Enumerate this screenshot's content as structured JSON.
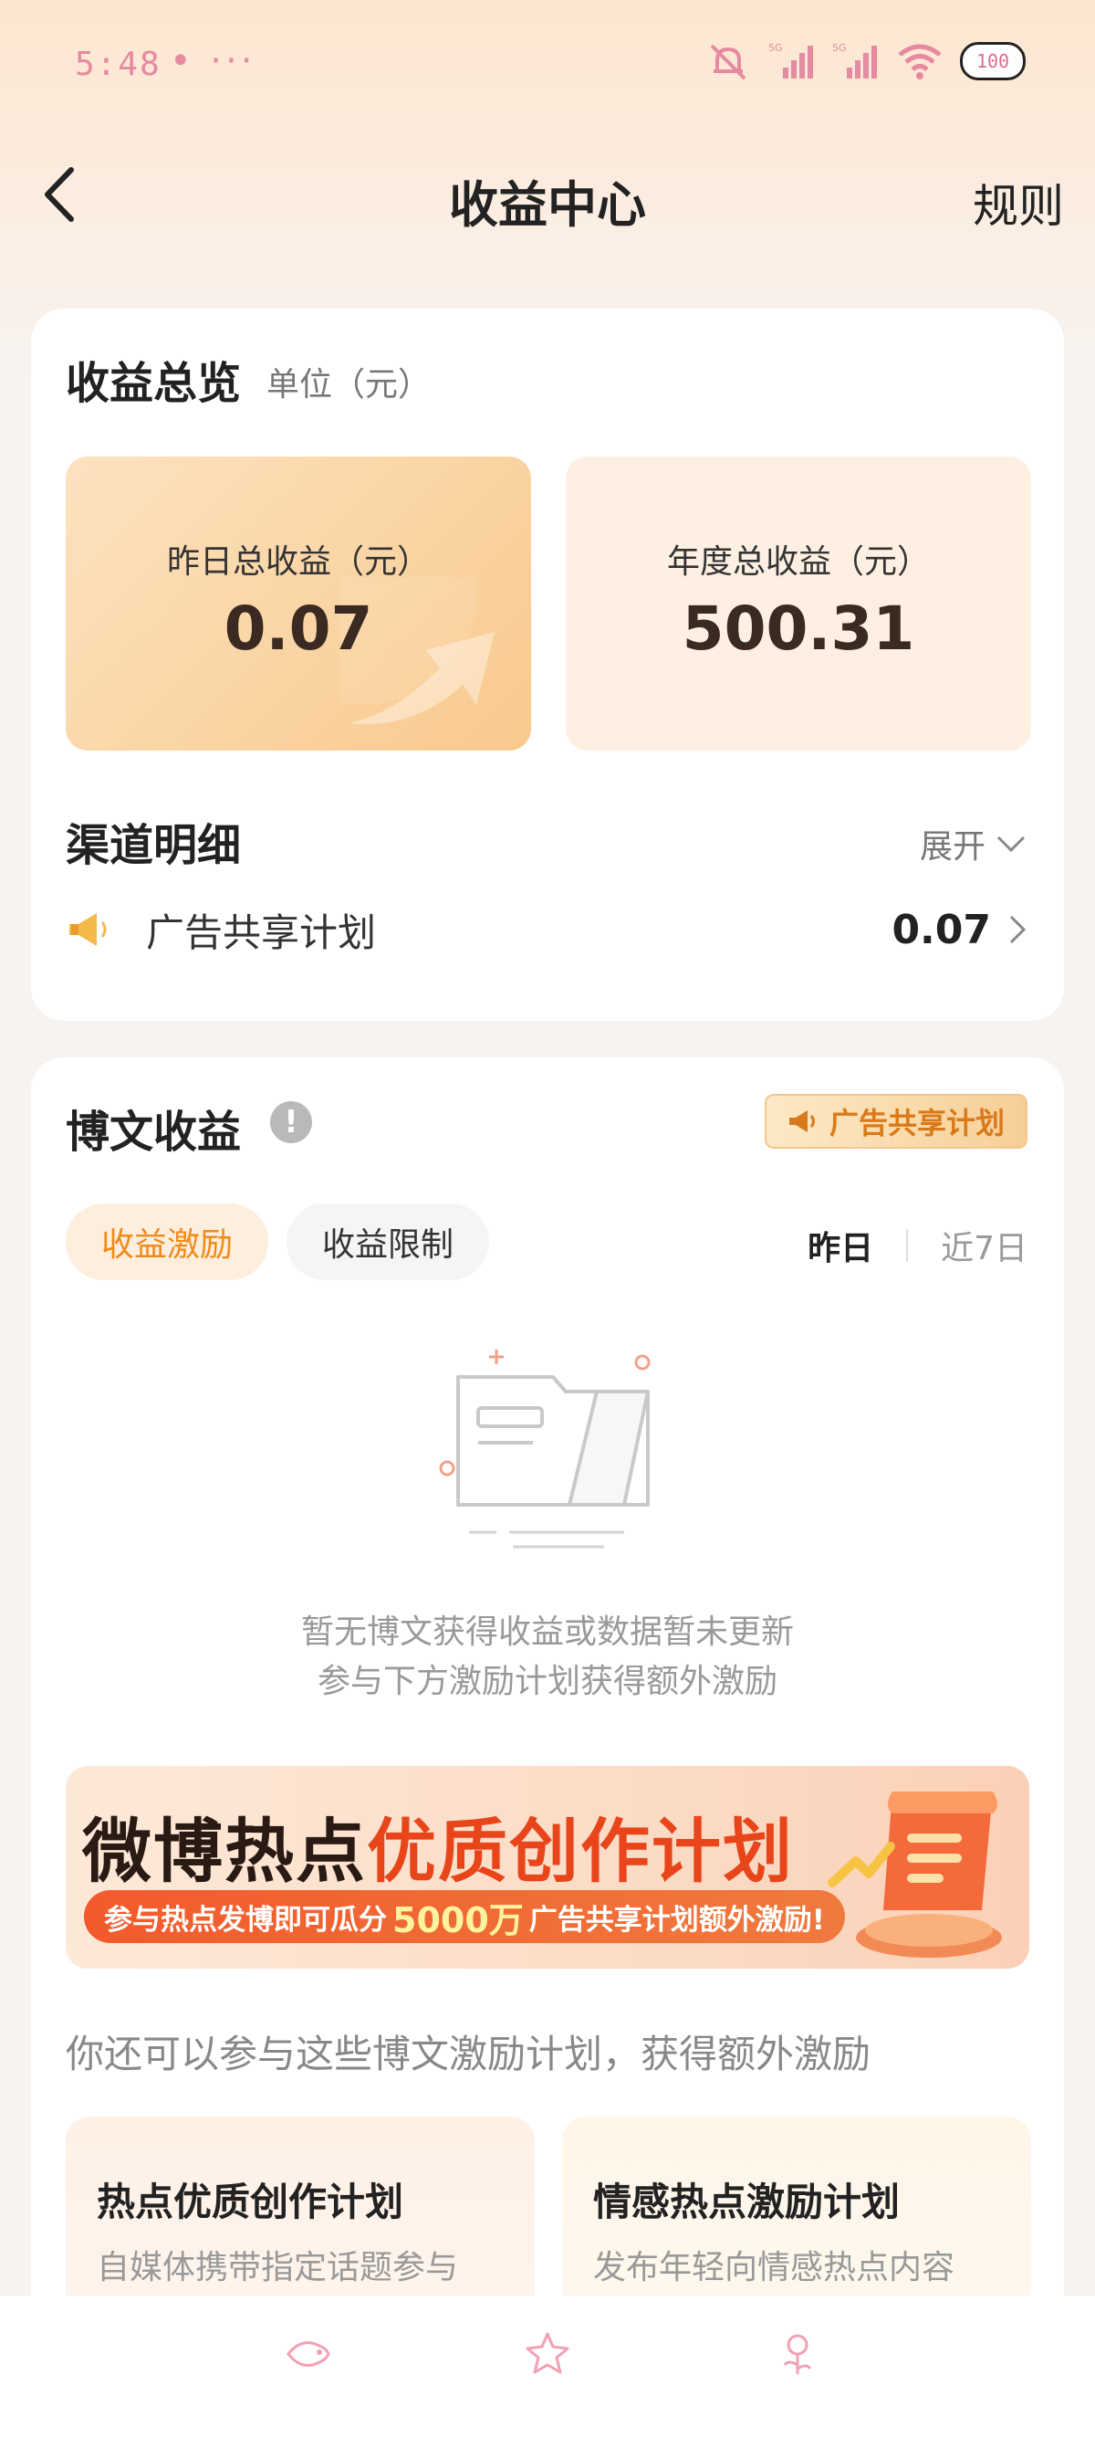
{
  "status_bar": {
    "time": "5:48",
    "dots": "• ···",
    "signal_label_1": "5G",
    "signal_label_2": "5G",
    "battery": "100"
  },
  "nav": {
    "title": "收益中心",
    "rules": "规则"
  },
  "overview": {
    "title": "收益总览",
    "unit": "单位（元）",
    "yesterday_label": "昨日总收益（元）",
    "yesterday_value": "0.07",
    "annual_label": "年度总收益（元）",
    "annual_value": "500.31"
  },
  "channel": {
    "title": "渠道明细",
    "expand": "展开",
    "items": [
      {
        "name": "广告共享计划",
        "value": "0.07",
        "icon": "megaphone-icon"
      }
    ]
  },
  "blog": {
    "title": "博文收益",
    "badge": "广告共享计划",
    "tabs": [
      "收益激励",
      "收益限制"
    ],
    "active_tab": "收益激励",
    "ranges": [
      "昨日",
      "近7日"
    ],
    "active_range": "昨日",
    "empty_line1": "暂无博文获得收益或数据暂未更新",
    "empty_line2": "参与下方激励计划获得额外激励"
  },
  "banner": {
    "title_part1": "微博热点",
    "title_part2": "优质创作计划",
    "sub_before": "参与热点发博即可瓜分",
    "sub_highlight": "5000万",
    "sub_after": "广告共享计划额外激励!"
  },
  "more": {
    "text": "你还可以参与这些博文激励计划，获得额外激励",
    "plans": [
      {
        "title": "热点优质创作计划",
        "desc": "自媒体携带指定话题参与"
      },
      {
        "title": "情感热点激励计划",
        "desc": "发布年轻向情感热点内容"
      }
    ]
  },
  "colors": {
    "accent": "#f08a1a",
    "banner_red": "#e8451a",
    "status_pink": "#e58aa0"
  }
}
